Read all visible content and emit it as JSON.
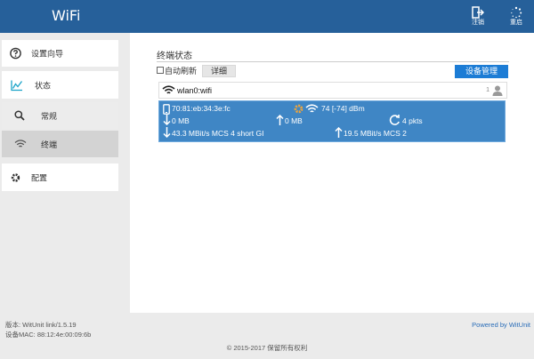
{
  "header": {
    "title": "WiFi",
    "logout_label": "注销",
    "reboot_label": "重启"
  },
  "sidebar": {
    "items": [
      {
        "label": "设置向导",
        "icon": "help-circle-icon"
      },
      {
        "label": "状态",
        "icon": "chart-line-icon"
      },
      {
        "label": "常规",
        "icon": "search-icon"
      },
      {
        "label": "终端",
        "icon": "wifi-icon"
      },
      {
        "label": "配置",
        "icon": "gear-icon"
      }
    ]
  },
  "main": {
    "section_title": "终端状态",
    "auto_refresh_label": "自动刷新",
    "auto_refresh_checked": false,
    "detail_tab_label": "详细",
    "manage_button_label": "设备管理",
    "interface": {
      "name": "wlan0:wifi",
      "client_count": "1"
    },
    "client": {
      "mac": "70:81:eb:34:3e:fc",
      "signal": "74 [-74] dBm",
      "rx_bytes": "0 MB",
      "tx_bytes": "0 MB",
      "packets": "4 pkts",
      "rx_rate": "43.3 MBit/s MCS 4 short GI",
      "tx_rate": "19.5 MBit/s MCS 2"
    }
  },
  "footer": {
    "version": "版本: WitUnit link/1.5.19",
    "mac": "设备MAC: 88:12:4e:00:09:6b",
    "powered_by": "Powered by WitUnit",
    "copyright": "© 2015-2017  保留所有权利"
  },
  "colors": {
    "header_bg": "#26609a",
    "accent": "#1c7cd5",
    "client_bg": "#3f86c5",
    "active_icon": "#1aa3c8"
  }
}
